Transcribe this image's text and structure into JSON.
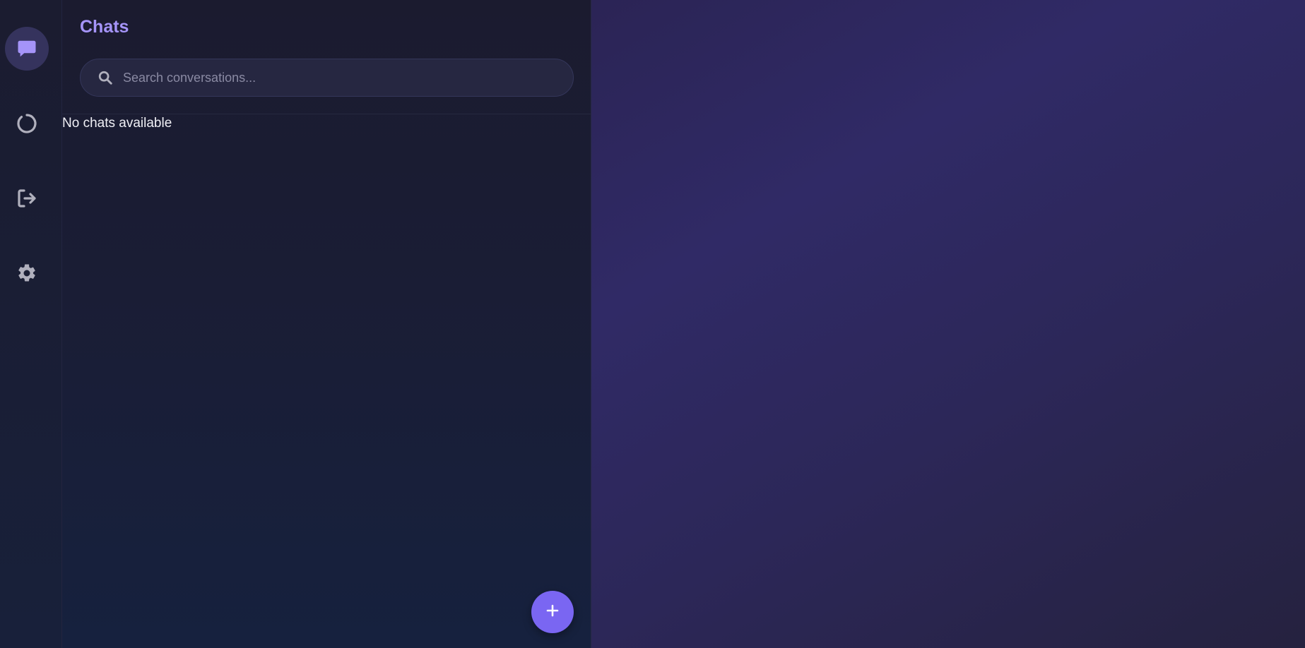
{
  "rail": {
    "items": [
      {
        "name": "chats",
        "icon": "chat-bubble-icon",
        "active": true
      },
      {
        "name": "status",
        "icon": "status-ring-icon",
        "active": false
      },
      {
        "name": "logout",
        "icon": "logout-icon",
        "active": false
      },
      {
        "name": "settings",
        "icon": "gear-icon",
        "active": false
      }
    ]
  },
  "panel": {
    "title": "Chats",
    "search_placeholder": "Search conversations...",
    "search_value": "",
    "empty_message": "No chats available",
    "fab_icon": "plus-icon"
  },
  "colors": {
    "accent": "#a594f9",
    "fab": "#7a66f2",
    "rail_active": "#35335d",
    "icon_gray": "#b0b0bd"
  }
}
